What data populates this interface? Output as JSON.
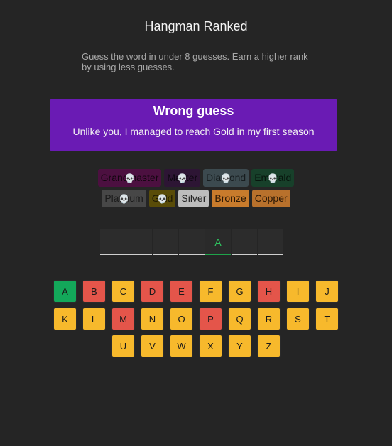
{
  "header": {
    "title": "Hangman Ranked",
    "subtitle": "Guess the word in under 8 guesses. Earn a higher rank by using less guesses."
  },
  "banner": {
    "title": "Wrong guess",
    "message": "Unlike you, I managed to reach Gold in my first season",
    "color": "#6a1bb4"
  },
  "ranks": {
    "row1": [
      "Grandmaster",
      "Master",
      "Diamond",
      "Emerald"
    ],
    "row2": [
      "Platinum",
      "Gold",
      "Silver",
      "Bronze",
      "Copper"
    ],
    "eliminated_icon": "skull-icon",
    "skull": "💀"
  },
  "word": {
    "slots": [
      "",
      "",
      "",
      "",
      "A",
      "",
      ""
    ]
  },
  "keyboard": {
    "colors": {
      "unused": "#f7b92c",
      "wrong": "#e4554a",
      "correct": "#13a85a"
    },
    "rows": [
      [
        {
          "letter": "A",
          "state": "correct"
        },
        {
          "letter": "B",
          "state": "wrong"
        },
        {
          "letter": "C",
          "state": "unused"
        },
        {
          "letter": "D",
          "state": "wrong"
        },
        {
          "letter": "E",
          "state": "wrong"
        },
        {
          "letter": "F",
          "state": "unused"
        },
        {
          "letter": "G",
          "state": "unused"
        },
        {
          "letter": "H",
          "state": "wrong"
        },
        {
          "letter": "I",
          "state": "unused"
        },
        {
          "letter": "J",
          "state": "unused"
        }
      ],
      [
        {
          "letter": "K",
          "state": "unused"
        },
        {
          "letter": "L",
          "state": "unused"
        },
        {
          "letter": "M",
          "state": "wrong"
        },
        {
          "letter": "N",
          "state": "unused"
        },
        {
          "letter": "O",
          "state": "unused"
        },
        {
          "letter": "P",
          "state": "wrong"
        },
        {
          "letter": "Q",
          "state": "unused"
        },
        {
          "letter": "R",
          "state": "unused"
        },
        {
          "letter": "S",
          "state": "unused"
        },
        {
          "letter": "T",
          "state": "unused"
        }
      ],
      [
        {
          "letter": "U",
          "state": "unused"
        },
        {
          "letter": "V",
          "state": "unused"
        },
        {
          "letter": "W",
          "state": "unused"
        },
        {
          "letter": "X",
          "state": "unused"
        },
        {
          "letter": "Y",
          "state": "unused"
        },
        {
          "letter": "Z",
          "state": "unused"
        }
      ]
    ]
  }
}
